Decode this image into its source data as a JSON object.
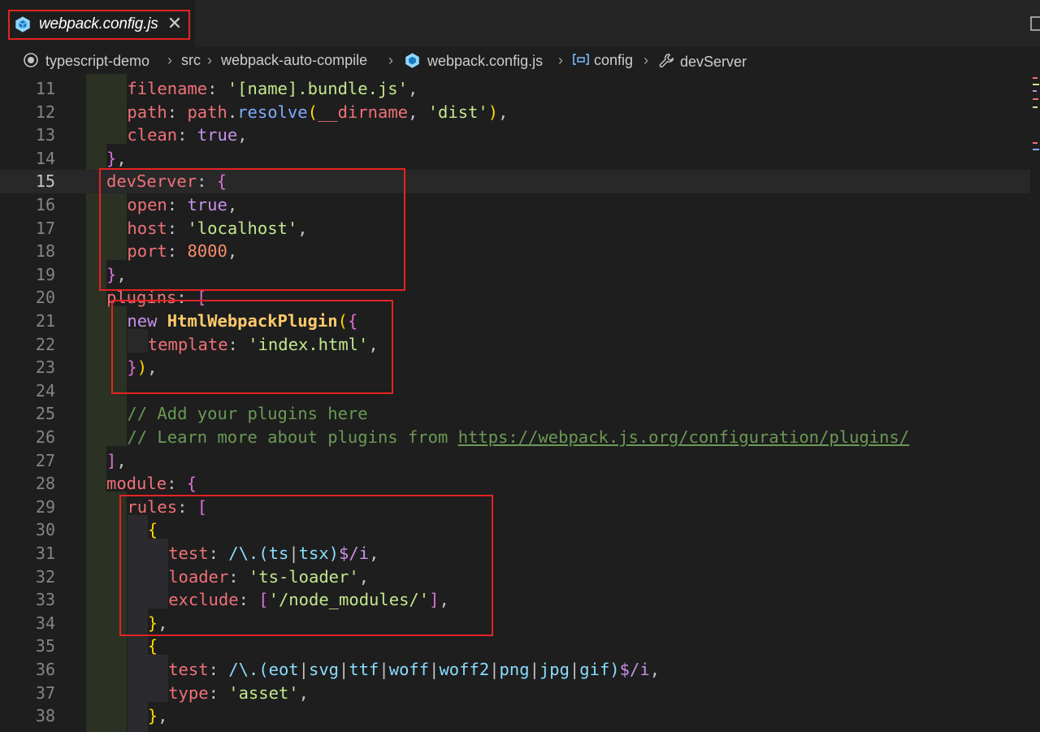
{
  "tab": {
    "title": "webpack.config.js",
    "close": "✕"
  },
  "breadcrumbs": [
    {
      "label": "typescript-demo",
      "icon": "repo-circle-icon"
    },
    {
      "label": "src",
      "icon": ""
    },
    {
      "label": "webpack-auto-compile",
      "icon": ""
    },
    {
      "label": "webpack.config.js",
      "icon": "webpack-cube-icon"
    },
    {
      "label": "config",
      "icon": "variable-icon"
    },
    {
      "label": "devServer",
      "icon": "wrench-icon"
    }
  ],
  "breadcrumb_separator": "›",
  "current_line": 15,
  "lines": [
    {
      "n": "11",
      "t": [
        [
          "p",
          "filename"
        ],
        [
          "pc",
          ": "
        ],
        [
          "s",
          "'[name].bundle.js'"
        ],
        [
          "pc",
          ","
        ]
      ]
    },
    {
      "n": "12",
      "t": [
        [
          "p",
          "path"
        ],
        [
          "pc",
          ": "
        ],
        [
          "p",
          "path"
        ],
        [
          "pc",
          "."
        ],
        [
          "f",
          "resolve"
        ],
        [
          "br1",
          "("
        ],
        [
          "v",
          "__dirname"
        ],
        [
          "pc",
          ", "
        ],
        [
          "s",
          "'dist'"
        ],
        [
          "br1",
          ")"
        ],
        [
          "pc",
          ","
        ]
      ]
    },
    {
      "n": "13",
      "t": [
        [
          "p",
          "clean"
        ],
        [
          "pc",
          ": "
        ],
        [
          "k",
          "true"
        ],
        [
          "pc",
          ","
        ]
      ]
    },
    {
      "n": "14",
      "t": [
        [
          "br2",
          "}"
        ],
        [
          "pc",
          ","
        ]
      ]
    },
    {
      "n": "15",
      "t": [
        [
          "p",
          "devServer"
        ],
        [
          "pc",
          ": "
        ],
        [
          "br2",
          "{"
        ]
      ]
    },
    {
      "n": "16",
      "t": [
        [
          "p",
          "open"
        ],
        [
          "pc",
          ": "
        ],
        [
          "k",
          "true"
        ],
        [
          "pc",
          ","
        ]
      ]
    },
    {
      "n": "17",
      "t": [
        [
          "p",
          "host"
        ],
        [
          "pc",
          ": "
        ],
        [
          "s",
          "'localhost'"
        ],
        [
          "pc",
          ","
        ]
      ]
    },
    {
      "n": "18",
      "t": [
        [
          "p",
          "port"
        ],
        [
          "pc",
          ": "
        ],
        [
          "n",
          "8000"
        ],
        [
          "pc",
          ","
        ]
      ]
    },
    {
      "n": "19",
      "t": [
        [
          "br2",
          "}"
        ],
        [
          "pc",
          ","
        ]
      ]
    },
    {
      "n": "20",
      "t": [
        [
          "p",
          "plugins"
        ],
        [
          "pc",
          ": "
        ],
        [
          "br2",
          "["
        ]
      ]
    },
    {
      "n": "21",
      "t": [
        [
          "k",
          "new "
        ],
        [
          "cls",
          "HtmlWebpackPlugin"
        ],
        [
          "br1",
          "("
        ],
        [
          "br2",
          "{"
        ]
      ]
    },
    {
      "n": "22",
      "t": [
        [
          "p",
          "template"
        ],
        [
          "pc",
          ": "
        ],
        [
          "s",
          "'index.html'"
        ],
        [
          "pc",
          ","
        ]
      ]
    },
    {
      "n": "23",
      "t": [
        [
          "br2",
          "}"
        ],
        [
          "br1",
          ")"
        ],
        [
          "pc",
          ","
        ]
      ]
    },
    {
      "n": "24",
      "t": []
    },
    {
      "n": "25",
      "t": [
        [
          "c",
          "// Add your plugins here"
        ]
      ]
    },
    {
      "n": "26",
      "t": [
        [
          "c",
          "// Learn more about plugins from "
        ],
        [
          "u",
          "https://webpack.js.org/configuration/plugins/"
        ]
      ]
    },
    {
      "n": "27",
      "t": [
        [
          "br2",
          "]"
        ],
        [
          "pc",
          ","
        ]
      ]
    },
    {
      "n": "28",
      "t": [
        [
          "p",
          "module"
        ],
        [
          "pc",
          ": "
        ],
        [
          "br2",
          "{"
        ]
      ]
    },
    {
      "n": "29",
      "t": [
        [
          "p",
          "rules"
        ],
        [
          "pc",
          ": "
        ],
        [
          "br2",
          "["
        ]
      ]
    },
    {
      "n": "30",
      "t": [
        [
          "br1",
          "{"
        ]
      ]
    },
    {
      "n": "31",
      "t": [
        [
          "p",
          "test"
        ],
        [
          "pc",
          ": "
        ],
        [
          "rx",
          "/\\.(ts"
        ],
        [
          "pc",
          "|"
        ],
        [
          "rx",
          "tsx)"
        ],
        [
          "rxs",
          "$/i"
        ],
        [
          "pc",
          ","
        ]
      ]
    },
    {
      "n": "32",
      "t": [
        [
          "p",
          "loader"
        ],
        [
          "pc",
          ": "
        ],
        [
          "s",
          "'ts-loader'"
        ],
        [
          "pc",
          ","
        ]
      ]
    },
    {
      "n": "33",
      "t": [
        [
          "p",
          "exclude"
        ],
        [
          "pc",
          ": "
        ],
        [
          "br2",
          "["
        ],
        [
          "s",
          "'/node_modules/'"
        ],
        [
          "br2",
          "]"
        ],
        [
          "pc",
          ","
        ]
      ]
    },
    {
      "n": "34",
      "t": [
        [
          "br1",
          "}"
        ],
        [
          "pc",
          ","
        ]
      ]
    },
    {
      "n": "35",
      "t": [
        [
          "br1",
          "{"
        ]
      ]
    },
    {
      "n": "36",
      "t": [
        [
          "p",
          "test"
        ],
        [
          "pc",
          ": "
        ],
        [
          "rx",
          "/\\.(eot"
        ],
        [
          "pc",
          "|"
        ],
        [
          "rx",
          "svg"
        ],
        [
          "pc",
          "|"
        ],
        [
          "rx",
          "ttf"
        ],
        [
          "pc",
          "|"
        ],
        [
          "rx",
          "woff"
        ],
        [
          "pc",
          "|"
        ],
        [
          "rx",
          "woff2"
        ],
        [
          "pc",
          "|"
        ],
        [
          "rx",
          "png"
        ],
        [
          "pc",
          "|"
        ],
        [
          "rx",
          "jpg"
        ],
        [
          "pc",
          "|"
        ],
        [
          "rx",
          "gif)"
        ],
        [
          "rxs",
          "$/i"
        ],
        [
          "pc",
          ","
        ]
      ]
    },
    {
      "n": "37",
      "t": [
        [
          "p",
          "type"
        ],
        [
          "pc",
          ": "
        ],
        [
          "s",
          "'asset'"
        ],
        [
          "pc",
          ","
        ]
      ]
    },
    {
      "n": "38",
      "t": [
        [
          "br1",
          "}"
        ],
        [
          "pc",
          ","
        ]
      ]
    }
  ]
}
